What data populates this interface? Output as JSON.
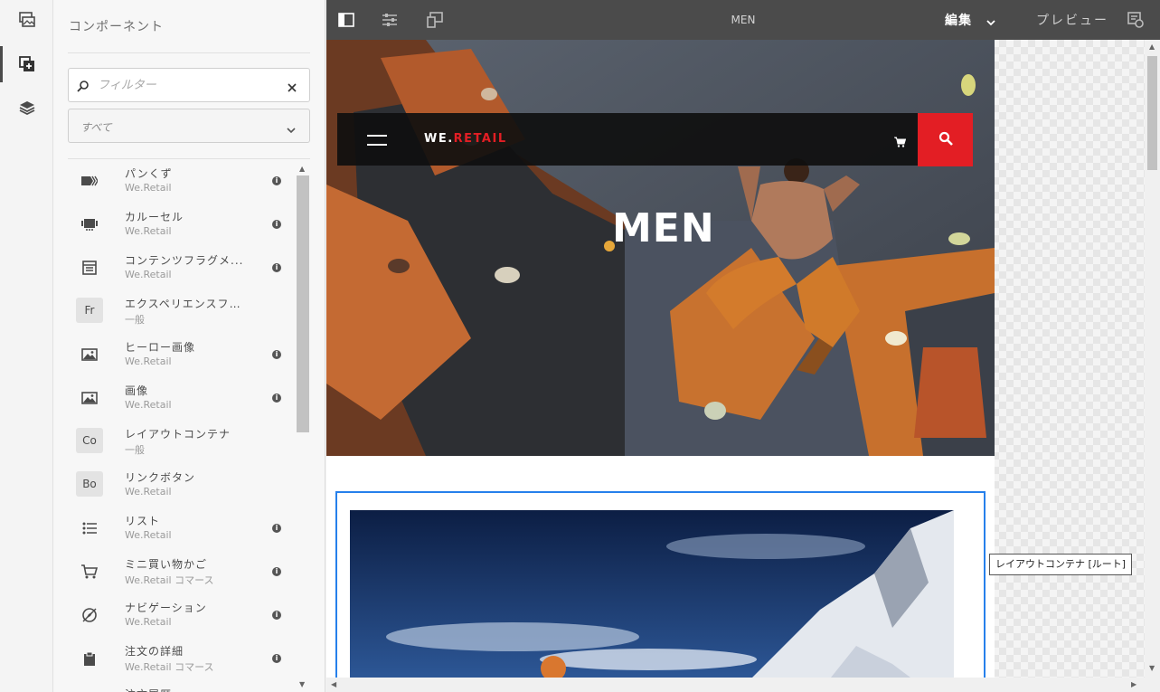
{
  "panel": {
    "title": "コンポーネント",
    "filter_placeholder": "フィルター",
    "group_select_value": "すべて"
  },
  "components": [
    {
      "name": "パンくず",
      "group": "We.Retail",
      "icon": "breadcrumb-icon"
    },
    {
      "name": "カルーセル",
      "group": "We.Retail",
      "icon": "carousel-icon"
    },
    {
      "name": "コンテンツフラグメ...",
      "group": "We.Retail",
      "icon": "content-fragment-icon"
    },
    {
      "name": "エクスペリエンスフラグメ...",
      "group": "一般",
      "abbr": "Fr"
    },
    {
      "name": "ヒーロー画像",
      "group": "We.Retail",
      "icon": "image-icon"
    },
    {
      "name": "画像",
      "group": "We.Retail",
      "icon": "image-icon"
    },
    {
      "name": "レイアウトコンテナ",
      "group": "一般",
      "abbr": "Co"
    },
    {
      "name": "リンクボタン",
      "group": "We.Retail",
      "abbr": "Bo"
    },
    {
      "name": "リスト",
      "group": "We.Retail",
      "icon": "list-icon"
    },
    {
      "name": "ミニ買い物かご",
      "group": "We.Retail コマース",
      "icon": "cart-icon"
    },
    {
      "name": "ナビゲーション",
      "group": "We.Retail",
      "icon": "navigation-icon"
    },
    {
      "name": "注文の詳細",
      "group": "We.Retail コマース",
      "icon": "clipboard-icon"
    },
    {
      "name": "注文履歴",
      "group": "",
      "icon": "list-icon"
    }
  ],
  "toolbar": {
    "page_name": "MEN",
    "mode_edit": "編集",
    "mode_preview": "プレビュー"
  },
  "page": {
    "brand_prefix": "WE.",
    "brand_suffix": "RETAIL",
    "hero_title": "MEN"
  },
  "tooltip": "レイアウトコンテナ [ルート]",
  "colors": {
    "accent": "#e31e24",
    "toolbar": "#4b4b4b",
    "selection": "#2680eb"
  }
}
